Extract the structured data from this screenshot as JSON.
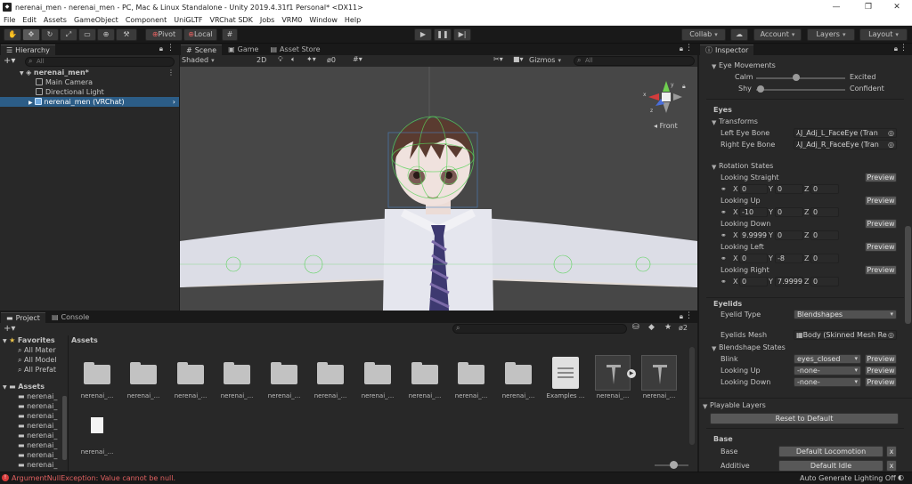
{
  "window": {
    "title": "nerenai_men - nerenai_men - PC, Mac & Linux Standalone - Unity 2019.4.31f1 Personal* <DX11>",
    "controls": [
      "—",
      "❐",
      "✕"
    ]
  },
  "menu": [
    "File",
    "Edit",
    "Assets",
    "GameObject",
    "Component",
    "UniGLTF",
    "VRChat SDK",
    "Jobs",
    "VRM0",
    "Window",
    "Help"
  ],
  "toolbar": {
    "pivot": "Pivot",
    "local": "Local",
    "collab": "Collab",
    "account": "Account",
    "layers": "Layers",
    "layout": "Layout"
  },
  "hierarchy": {
    "tab": "Hierarchy",
    "search_placeholder": "All",
    "items": [
      "nerenai_men*",
      "Main Camera",
      "Directional Light",
      "nerenai_men (VRChat)"
    ]
  },
  "scene": {
    "tabs": [
      "Scene",
      "Game",
      "Asset Store"
    ],
    "shading": "Shaded",
    "mode_2d": "2D",
    "fx_count": "0",
    "gizmos": "Gizmos",
    "search_placeholder": "All",
    "gizmo_label": "Front",
    "axis_labels": [
      "y",
      "x",
      "z"
    ]
  },
  "project": {
    "tabs": [
      "Project",
      "Console"
    ],
    "favorites_label": "Favorites",
    "favorites": [
      "All Mater",
      "All Model",
      "All Prefat"
    ],
    "assets_label": "Assets",
    "assets_tree": [
      "nerenai_",
      "nerenai_",
      "nerenai_",
      "nerenai_",
      "nerenai_",
      "nerenai_",
      "nerenai_",
      "nerenai_"
    ],
    "breadcrumb": "Assets",
    "hidden_count": "2",
    "grid_items": [
      {
        "label": "nerenai_...",
        "kind": "folder"
      },
      {
        "label": "nerenai_...",
        "kind": "folder"
      },
      {
        "label": "nerenai_...",
        "kind": "folder"
      },
      {
        "label": "nerenai_...",
        "kind": "folder"
      },
      {
        "label": "nerenai_...",
        "kind": "folder"
      },
      {
        "label": "nerenai_...",
        "kind": "folder"
      },
      {
        "label": "nerenai_...",
        "kind": "folder"
      },
      {
        "label": "nerenai_...",
        "kind": "folder"
      },
      {
        "label": "nerenai_...",
        "kind": "folder"
      },
      {
        "label": "nerenai_...",
        "kind": "folder"
      },
      {
        "label": "Examples ...",
        "kind": "doc"
      },
      {
        "label": "nerenai_...",
        "kind": "model"
      },
      {
        "label": "nerenai_...",
        "kind": "model"
      },
      {
        "label": "nerenai_...",
        "kind": "file"
      }
    ]
  },
  "inspector": {
    "tab": "Inspector",
    "eye_movements": "Eye Movements",
    "calm": "Calm",
    "excited": "Excited",
    "shy": "Shy",
    "confident": "Confident",
    "calm_excited_value": 0.45,
    "shy_confident_value": 0.05,
    "eyes_header": "Eyes",
    "transforms": "Transforms",
    "left_eye_bone": "Left Eye Bone",
    "left_eye_value": "J_Adj_L_FaceEye (Tran",
    "right_eye_bone": "Right Eye Bone",
    "right_eye_value": "J_Adj_R_FaceEye (Tran",
    "rotation_states": "Rotation States",
    "preview": "Preview",
    "rotations": [
      {
        "name": "Looking Straight",
        "x": "0",
        "y": "0",
        "z": "0"
      },
      {
        "name": "Looking Up",
        "x": "-10",
        "y": "0",
        "z": "0"
      },
      {
        "name": "Looking Down",
        "x": "9.9999",
        "y": "0",
        "z": "0"
      },
      {
        "name": "Looking Left",
        "x": "0",
        "y": "-8",
        "z": "0"
      },
      {
        "name": "Looking Right",
        "x": "0",
        "y": "7.9999",
        "z": "0"
      }
    ],
    "eyelids_header": "Eyelids",
    "eyelid_type_label": "Eyelid Type",
    "eyelid_type_value": "Blendshapes",
    "eyelids_mesh_label": "Eyelids Mesh",
    "eyelids_mesh_value": "Body (Skinned Mesh Re",
    "blendshape_states": "Blendshape States",
    "blendshapes": [
      {
        "name": "Blink",
        "value": "eyes_closed"
      },
      {
        "name": "Looking Up",
        "value": "-none-"
      },
      {
        "name": "Looking Down",
        "value": "-none-"
      }
    ],
    "playable_layers": "Playable Layers",
    "reset_default": "Reset to Default",
    "base_header": "Base",
    "base_rows": [
      {
        "name": "Base",
        "value": "Default Locomotion"
      },
      {
        "name": "Additive",
        "value": "Default Idle"
      }
    ],
    "x_label": "X",
    "y_label": "Y",
    "z_label": "Z",
    "remove": "x"
  },
  "status": {
    "error": "ArgumentNullException: Value cannot be null.",
    "lighting": "Auto Generate Lighting Off"
  }
}
